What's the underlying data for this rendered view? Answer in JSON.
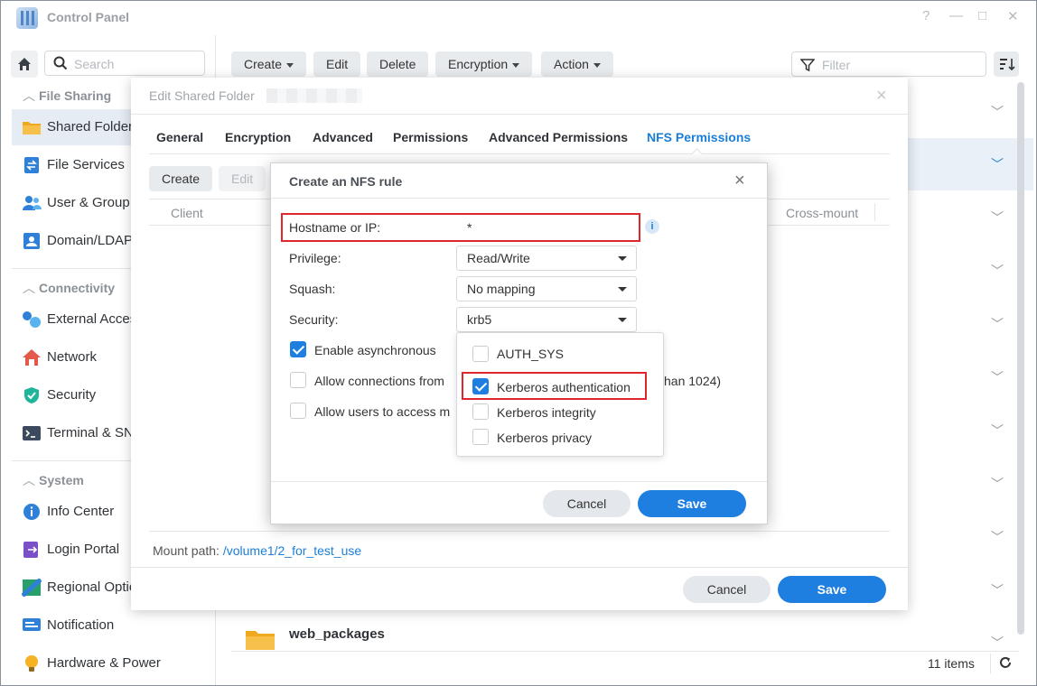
{
  "window": {
    "title": "Control Panel",
    "controls": [
      "?",
      "—",
      "□",
      "✕"
    ]
  },
  "sidebar": {
    "search_placeholder": "Search",
    "sections": [
      {
        "label": "File Sharing",
        "items": [
          {
            "label": "Shared Folder",
            "icon": "folder-icon",
            "active": true
          },
          {
            "label": "File Services",
            "icon": "file-services-icon"
          },
          {
            "label": "User & Group",
            "icon": "users-icon"
          },
          {
            "label": "Domain/LDAP",
            "icon": "domain-icon"
          }
        ]
      },
      {
        "label": "Connectivity",
        "items": [
          {
            "label": "External Access",
            "icon": "external-access-icon"
          },
          {
            "label": "Network",
            "icon": "network-icon"
          },
          {
            "label": "Security",
            "icon": "shield-icon"
          },
          {
            "label": "Terminal & SNMP",
            "icon": "terminal-icon"
          }
        ]
      },
      {
        "label": "System",
        "items": [
          {
            "label": "Info Center",
            "icon": "info-icon"
          },
          {
            "label": "Login Portal",
            "icon": "login-portal-icon"
          },
          {
            "label": "Regional Options",
            "icon": "regional-icon"
          },
          {
            "label": "Notification",
            "icon": "notification-icon"
          },
          {
            "label": "Hardware & Power",
            "icon": "bulb-icon"
          }
        ]
      }
    ]
  },
  "toolbar": {
    "create": "Create",
    "edit": "Edit",
    "delete": "Delete",
    "encryption": "Encryption",
    "action": "Action",
    "filter_placeholder": "Filter"
  },
  "main": {
    "last_folder_name": "web_packages",
    "items_count": "11 items"
  },
  "edit_dialog": {
    "title": "Edit Shared Folder",
    "tabs": [
      "General",
      "Encryption",
      "Advanced",
      "Permissions",
      "Advanced Permissions",
      "NFS Permissions"
    ],
    "active_tab": "NFS Permissions",
    "create": "Create",
    "edit": "Edit",
    "col_client": "Client",
    "col_crossmount": "Cross-mount",
    "mount_label": "Mount path:",
    "mount_path": "/volume1/2_for_test_use",
    "cancel": "Cancel",
    "save": "Save"
  },
  "nfs_dialog": {
    "title": "Create an NFS rule",
    "hostname_label": "Hostname or IP:",
    "hostname_value": "*",
    "privilege_label": "Privilege:",
    "privilege_value": "Read/Write",
    "squash_label": "Squash:",
    "squash_value": "No mapping",
    "security_label": "Security:",
    "security_value": "krb5",
    "opt_async": "Enable asynchronous",
    "opt_conn": "Allow connections from",
    "opt_conn_tail": "han 1024)",
    "opt_users": "Allow users to access m",
    "security_options": [
      {
        "label": "AUTH_SYS",
        "checked": false
      },
      {
        "label": "Kerberos authentication",
        "checked": true
      },
      {
        "label": "Kerberos integrity",
        "checked": false
      },
      {
        "label": "Kerberos privacy",
        "checked": false
      }
    ],
    "cancel": "Cancel",
    "save": "Save"
  }
}
